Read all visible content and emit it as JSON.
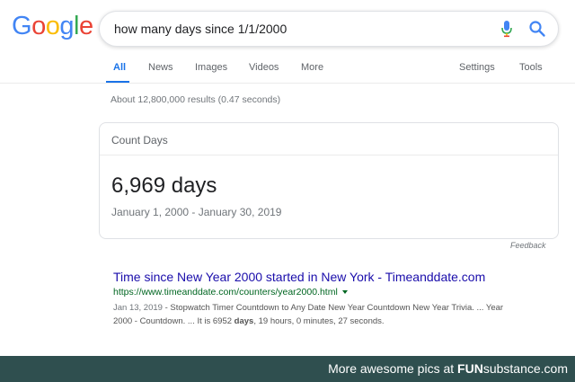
{
  "logo": {
    "letters": [
      "G",
      "o",
      "o",
      "g",
      "l",
      "e"
    ],
    "colors": [
      "#4285F4",
      "#EA4335",
      "#FBBC05",
      "#4285F4",
      "#34A853",
      "#EA4335"
    ]
  },
  "search": {
    "query": "how many days since 1/1/2000"
  },
  "tabs": {
    "all": "All",
    "news": "News",
    "images": "Images",
    "videos": "Videos",
    "more": "More",
    "settings": "Settings",
    "tools": "Tools"
  },
  "results_stats": "About 12,800,000 results (0.47 seconds)",
  "card": {
    "title": "Count Days",
    "value": "6,969 days",
    "range": "January 1, 2000 - January 30, 2019"
  },
  "feedback": "Feedback",
  "result": {
    "title": "Time since New Year 2000 started in New York - Timeanddate.com",
    "url": "https://www.timeanddate.com/counters/year2000.html",
    "date": "Jan 13, 2019",
    "snippet_line1": " - Stopwatch Timer Countdown to Any Date New Year Countdown New Year Trivia. ... Year",
    "snippet_line2_pre": "2000 - Countdown. ... It is 6952 ",
    "snippet_bold": "days",
    "snippet_line2_post": ", 19 hours, 0 minutes, 27 seconds."
  },
  "footer": {
    "prefix": "More awesome pics at ",
    "brand_a": "FUN",
    "brand_b": "substance",
    "suffix": ".com"
  }
}
